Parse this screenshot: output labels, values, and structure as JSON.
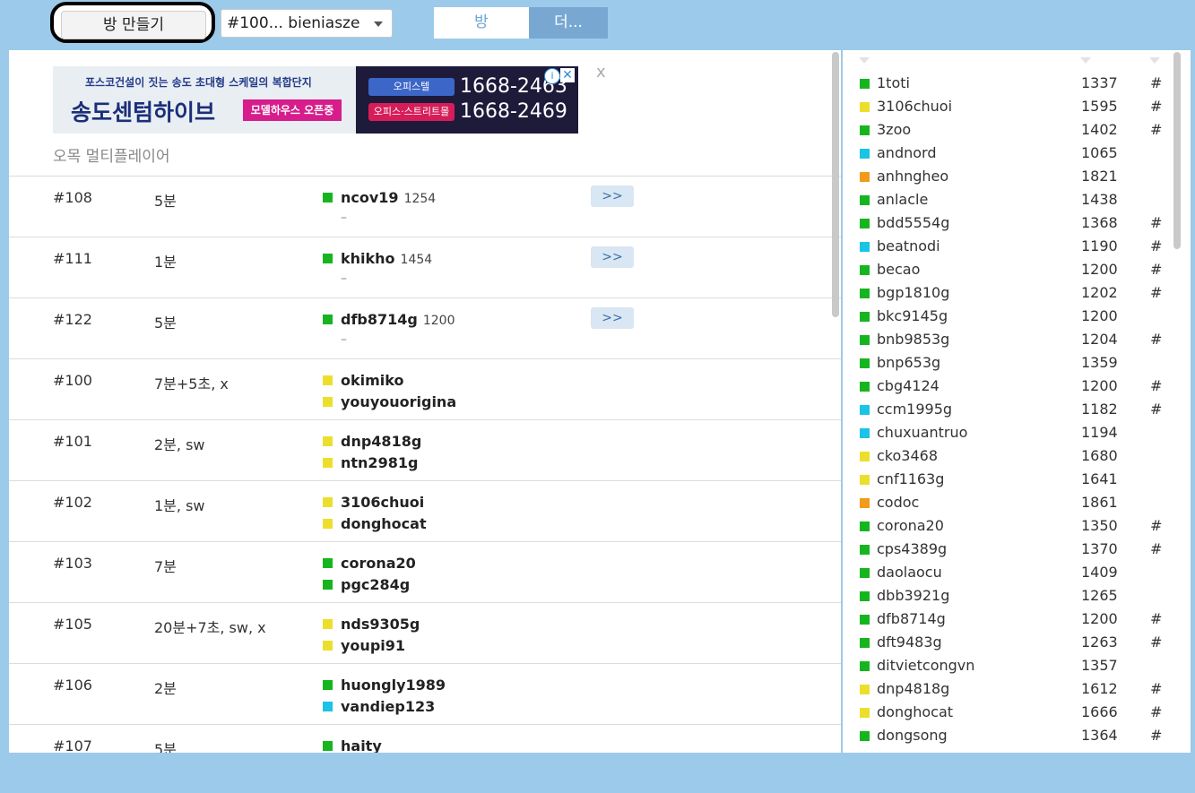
{
  "colors": {
    "green": "#16b51f",
    "yellow": "#ecdf2c",
    "cyan": "#1bc3e6",
    "orange": "#f29a1b"
  },
  "toolbar": {
    "create_room_label": "방 만들기",
    "room_select_value": "#100... bieniasze",
    "tab_room_label": "방",
    "tab_more_label": "더..."
  },
  "ad": {
    "top_line": "포스코건설이 짓는 송도 초대형 스케일의 복합단지",
    "title": "송도센텀하이브",
    "badge": "모델하우스 오픈중",
    "pill1": "오피스텔",
    "pill2": "오피스·스트리트몰",
    "phone1": "1668-2463",
    "phone2": "1668-2469",
    "info_label": "i",
    "x_label": "✕",
    "close_label": "x"
  },
  "main": {
    "subtitle": "오목 멀티플레이어",
    "join_label": ">>",
    "empty_seat": "–",
    "rooms": [
      {
        "id": "#108",
        "time": "5분",
        "join": true,
        "players": [
          {
            "name": "ncov19",
            "rating": "1254",
            "color": "green"
          }
        ]
      },
      {
        "id": "#111",
        "time": "1분",
        "join": true,
        "players": [
          {
            "name": "khikho",
            "rating": "1454",
            "color": "green"
          }
        ]
      },
      {
        "id": "#122",
        "time": "5분",
        "join": true,
        "players": [
          {
            "name": "dfb8714g",
            "rating": "1200",
            "color": "green"
          }
        ]
      },
      {
        "id": "#100",
        "time": "7분+5초, x",
        "join": false,
        "players": [
          {
            "name": "okimiko",
            "color": "yellow"
          },
          {
            "name": "youyouorigina",
            "color": "yellow"
          }
        ]
      },
      {
        "id": "#101",
        "time": "2분, sw",
        "join": false,
        "players": [
          {
            "name": "dnp4818g",
            "color": "yellow"
          },
          {
            "name": "ntn2981g",
            "color": "yellow"
          }
        ]
      },
      {
        "id": "#102",
        "time": "1분, sw",
        "join": false,
        "players": [
          {
            "name": "3106chuoi",
            "color": "yellow"
          },
          {
            "name": "donghocat",
            "color": "yellow"
          }
        ]
      },
      {
        "id": "#103",
        "time": "7분",
        "join": false,
        "players": [
          {
            "name": "corona20",
            "color": "green"
          },
          {
            "name": "pgc284g",
            "color": "green"
          }
        ]
      },
      {
        "id": "#105",
        "time": "20분+7초, sw, x",
        "join": false,
        "players": [
          {
            "name": "nds9305g",
            "color": "yellow"
          },
          {
            "name": "youpi91",
            "color": "yellow"
          }
        ]
      },
      {
        "id": "#106",
        "time": "2분",
        "join": false,
        "players": [
          {
            "name": "huongly1989",
            "color": "green"
          },
          {
            "name": "vandiep123",
            "color": "cyan"
          }
        ]
      },
      {
        "id": "#107",
        "time": "5분",
        "join": false,
        "players": [
          {
            "name": "haity",
            "color": "green"
          }
        ]
      }
    ]
  },
  "users": [
    {
      "name": "1toti",
      "rating": "1337",
      "flag": "#",
      "color": "green"
    },
    {
      "name": "3106chuoi",
      "rating": "1595",
      "flag": "#",
      "color": "yellow"
    },
    {
      "name": "3zoo",
      "rating": "1402",
      "flag": "#",
      "color": "green"
    },
    {
      "name": "andnord",
      "rating": "1065",
      "flag": "",
      "color": "cyan"
    },
    {
      "name": "anhngheo",
      "rating": "1821",
      "flag": "",
      "color": "orange"
    },
    {
      "name": "anlacle",
      "rating": "1438",
      "flag": "",
      "color": "green"
    },
    {
      "name": "bdd5554g",
      "rating": "1368",
      "flag": "#",
      "color": "green"
    },
    {
      "name": "beatnodi",
      "rating": "1190",
      "flag": "#",
      "color": "cyan"
    },
    {
      "name": "becao",
      "rating": "1200",
      "flag": "#",
      "color": "green"
    },
    {
      "name": "bgp1810g",
      "rating": "1202",
      "flag": "#",
      "color": "green"
    },
    {
      "name": "bkc9145g",
      "rating": "1200",
      "flag": "",
      "color": "green"
    },
    {
      "name": "bnb9853g",
      "rating": "1204",
      "flag": "#",
      "color": "green"
    },
    {
      "name": "bnp653g",
      "rating": "1359",
      "flag": "",
      "color": "green"
    },
    {
      "name": "cbg4124",
      "rating": "1200",
      "flag": "#",
      "color": "green"
    },
    {
      "name": "ccm1995g",
      "rating": "1182",
      "flag": "#",
      "color": "cyan"
    },
    {
      "name": "chuxuantruo",
      "rating": "1194",
      "flag": "",
      "color": "cyan"
    },
    {
      "name": "cko3468",
      "rating": "1680",
      "flag": "",
      "color": "yellow"
    },
    {
      "name": "cnf1163g",
      "rating": "1641",
      "flag": "",
      "color": "yellow"
    },
    {
      "name": "codoc",
      "rating": "1861",
      "flag": "",
      "color": "orange"
    },
    {
      "name": "corona20",
      "rating": "1350",
      "flag": "#",
      "color": "green"
    },
    {
      "name": "cps4389g",
      "rating": "1370",
      "flag": "#",
      "color": "green"
    },
    {
      "name": "daolaocu",
      "rating": "1409",
      "flag": "",
      "color": "green"
    },
    {
      "name": "dbb3921g",
      "rating": "1265",
      "flag": "",
      "color": "green"
    },
    {
      "name": "dfb8714g",
      "rating": "1200",
      "flag": "#",
      "color": "green"
    },
    {
      "name": "dft9483g",
      "rating": "1263",
      "flag": "#",
      "color": "green"
    },
    {
      "name": "ditvietcongvn",
      "rating": "1357",
      "flag": "",
      "color": "green"
    },
    {
      "name": "dnp4818g",
      "rating": "1612",
      "flag": "#",
      "color": "yellow"
    },
    {
      "name": "donghocat",
      "rating": "1666",
      "flag": "#",
      "color": "yellow"
    },
    {
      "name": "dongsong",
      "rating": "1364",
      "flag": "#",
      "color": "green"
    }
  ]
}
